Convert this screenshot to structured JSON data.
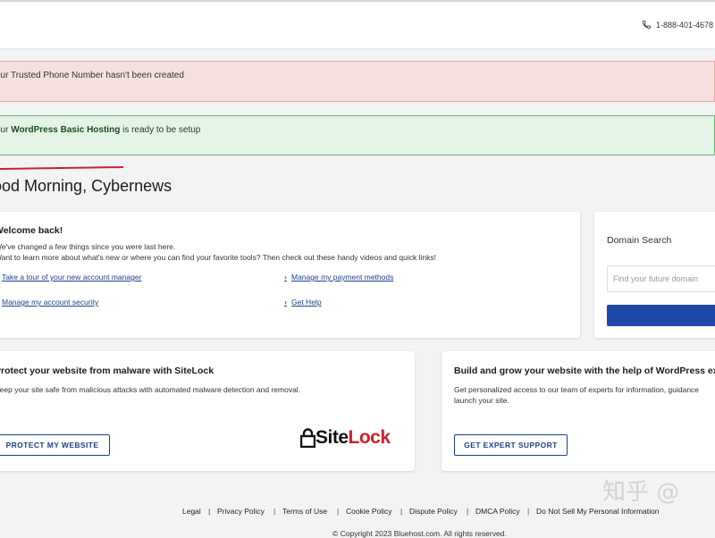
{
  "header": {
    "phone_number": "1-888-401-4678"
  },
  "alerts": {
    "phone_alert": "our Trusted Phone Number hasn't been created",
    "hosting_prefix": "our ",
    "hosting_product": "WordPress Basic Hosting",
    "hosting_suffix": " is ready to be setup"
  },
  "greeting": "ood Morning, Cybernews",
  "welcome": {
    "title": "Welcome back!",
    "line1": "We've changed a few things since you were last here.",
    "line2": "Want to learn more about what's new or where you can find your favorite tools? Then check out these handy videos and quick links!",
    "links": [
      "Take a tour of your new account manager",
      "Manage my payment methods",
      "Manage my account security",
      "Get Help"
    ]
  },
  "domain_search": {
    "title": "Domain Search",
    "placeholder": "Find your future domain"
  },
  "sitelock_card": {
    "title": "Protect your website from malware with SiteLock",
    "description": "Keep your site safe from malicious attacks with automated malware detection and removal.",
    "button": "PROTECT MY WEBSITE",
    "logo_site": "Site",
    "logo_lock": "Lock"
  },
  "expert_card": {
    "title": "Build and grow your website with the help of WordPress expe",
    "description_line1": "Get personalized access to our team of experts for information, guidance",
    "description_line2": "launch your site.",
    "button": "GET EXPERT SUPPORT"
  },
  "footer": {
    "links": [
      "Legal",
      "Privacy Policy",
      "Terms of Use",
      "Cookie Policy",
      "Dispute Policy",
      "DMCA Policy",
      "Do Not Sell My Personal Information"
    ],
    "separator": "|",
    "copyright": "© Copyright 2023 Bluehost.com. All rights reserved."
  },
  "watermark": "知乎 @",
  "colors": {
    "accent_blue": "#1e49a8",
    "sitelock_red": "#d11e28",
    "error_bg": "#f6e1e1",
    "success_bg": "#e4f4e7"
  }
}
